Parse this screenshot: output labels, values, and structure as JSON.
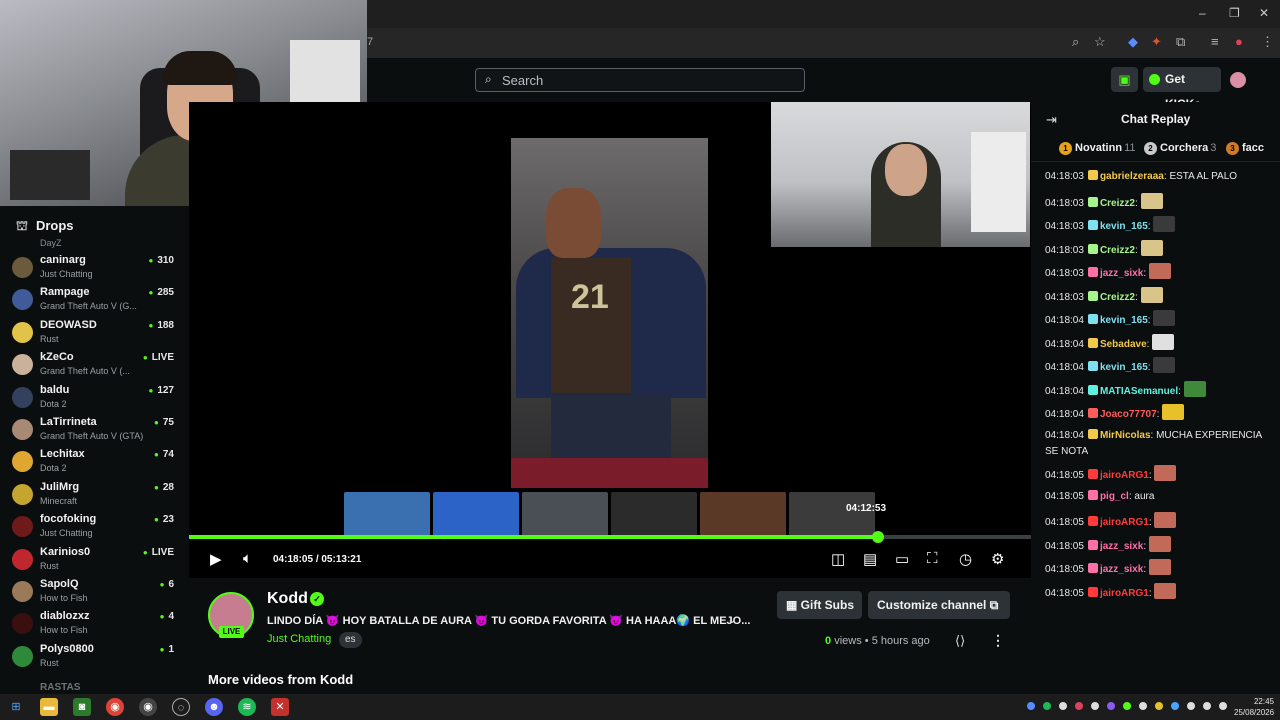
{
  "browser": {
    "address_fragment": "7",
    "window_controls": {
      "minimize": "–",
      "restore": "❐",
      "close": "✕"
    }
  },
  "header": {
    "search_placeholder": "Search",
    "get_kicks_label": "Get KICKs"
  },
  "sidebar": {
    "title": "Drops",
    "cut_top_text": "DayZ",
    "channels": [
      {
        "name": "caninarg",
        "category": "Just Chatting",
        "viewers": "310",
        "avatar_color": "#6b5a3c"
      },
      {
        "name": "Rampage",
        "category": "Grand Theft Auto V (G...",
        "viewers": "285",
        "avatar_color": "#3f5b9a"
      },
      {
        "name": "DEOWASD",
        "category": "Rust",
        "viewers": "188",
        "avatar_color": "#e2c34a"
      },
      {
        "name": "kZeCo",
        "category": "Grand Theft Auto V (...",
        "viewers": "LIVE",
        "avatar_color": "#c9b19a"
      },
      {
        "name": "baldu",
        "category": "Dota 2",
        "viewers": "127",
        "avatar_color": "#33415f"
      },
      {
        "name": "LaTirrineta",
        "category": "Grand Theft Auto V (GTA)",
        "viewers": "75",
        "avatar_color": "#a88a74"
      },
      {
        "name": "Lechitax",
        "category": "Dota 2",
        "viewers": "74",
        "avatar_color": "#e0a632"
      },
      {
        "name": "JuliMrg",
        "category": "Minecraft",
        "viewers": "28",
        "avatar_color": "#c3a52f"
      },
      {
        "name": "focofoking",
        "category": "Just Chatting",
        "viewers": "23",
        "avatar_color": "#6e1a1a"
      },
      {
        "name": "Karinios0",
        "category": "Rust",
        "viewers": "LIVE",
        "avatar_color": "#c0262e"
      },
      {
        "name": "SapolQ",
        "category": "How to Fish",
        "viewers": "6",
        "avatar_color": "#9b7a5a"
      },
      {
        "name": "diablozxz",
        "category": "How to Fish",
        "viewers": "4",
        "avatar_color": "#3a0f10"
      },
      {
        "name": "Polys0800",
        "category": "Rust",
        "viewers": "1",
        "avatar_color": "#2e8a3a"
      }
    ],
    "bottom_cut_text": "RASTAS"
  },
  "player": {
    "hover_timecode": "04:12:53",
    "current_time": "04:18:05",
    "separator": "/",
    "duration": "05:13:21",
    "progress_fraction": 0.818,
    "thumb_colors": [
      "#3a6fb0",
      "#2b63c7",
      "#4a4f55",
      "#2b2b2b",
      "#5a3a26",
      "#3b3b3b"
    ]
  },
  "stream": {
    "streamer": "Kodd",
    "live_label": "LIVE",
    "title": "LINDO DÍA 😈 HOY BATALLA DE AURA 😈 TU GORDA FAVORITA 😈 HA HAAA🌍 EL MEJO...",
    "category": "Just Chatting",
    "language": "es",
    "gift_subs_label": "Gift Subs",
    "customize_label": "Customize channel",
    "views_count": "0",
    "views_label": "views",
    "age": "5 hours ago",
    "more_videos_label": "More videos from Kodd"
  },
  "chat": {
    "title": "Chat Replay",
    "leaderboard": [
      {
        "rank": "1",
        "name": "Novatinn",
        "count": "11",
        "color": "#e8a21a"
      },
      {
        "rank": "2",
        "name": "Corchera",
        "count": "3",
        "color": "#c9c9c9"
      },
      {
        "rank": "3",
        "name": "facc",
        "count": "",
        "color": "#d07a2a"
      }
    ],
    "messages": [
      {
        "time": "04:18:03",
        "user": "gabrielzeraaa",
        "text": "ESTA AL PALO",
        "color": "#f2c94c",
        "emote": ""
      },
      {
        "time": "04:18:03",
        "user": "Creizz2",
        "text": "",
        "color": "#a6f58a",
        "emote": "#d9c48a"
      },
      {
        "time": "04:18:03",
        "user": "kevin_165",
        "text": "",
        "color": "#7ee0f0",
        "emote": "#3a3a3a"
      },
      {
        "time": "04:18:03",
        "user": "Creizz2",
        "text": "",
        "color": "#a6f58a",
        "emote": "#d9c48a"
      },
      {
        "time": "04:18:03",
        "user": "jazz_sixk",
        "text": "",
        "color": "#ff6fa8",
        "emote": "#c26a5a"
      },
      {
        "time": "04:18:03",
        "user": "Creizz2",
        "text": "",
        "color": "#a6f58a",
        "emote": "#d9c48a"
      },
      {
        "time": "04:18:04",
        "user": "kevin_165",
        "text": "",
        "color": "#7ee0f0",
        "emote": "#3a3a3a"
      },
      {
        "time": "04:18:04",
        "user": "Sebadave",
        "text": "",
        "color": "#f2c94c",
        "emote": "#e0e0e0"
      },
      {
        "time": "04:18:04",
        "user": "kevin_165",
        "text": "",
        "color": "#7ee0f0",
        "emote": "#3a3a3a"
      },
      {
        "time": "04:18:04",
        "user": "MATIASemanuel",
        "text": "",
        "color": "#5ff0e0",
        "emote": "#3e8a3a"
      },
      {
        "time": "04:18:04",
        "user": "Joaco77707",
        "text": "",
        "color": "#ff5c5c",
        "emote": "#e8c02a"
      },
      {
        "time": "04:18:04",
        "user": "MirNicolas",
        "text": "MUCHA EXPERIENCIA SE NOTA",
        "color": "#f2c94c",
        "emote": ""
      },
      {
        "time": "04:18:05",
        "user": "jairoARG1",
        "text": "",
        "color": "#ff3b3b",
        "emote": "#c26a5a"
      },
      {
        "time": "04:18:05",
        "user": "pig_cl",
        "text": "aura",
        "color": "#ff6fa8",
        "emote": ""
      },
      {
        "time": "04:18:05",
        "user": "jairoARG1",
        "text": "",
        "color": "#ff3b3b",
        "emote": "#c26a5a"
      },
      {
        "time": "04:18:05",
        "user": "jazz_sixk",
        "text": "",
        "color": "#ff6fa8",
        "emote": "#c26a5a"
      },
      {
        "time": "04:18:05",
        "user": "jazz_sixk",
        "text": "",
        "color": "#ff6fa8",
        "emote": "#c26a5a"
      },
      {
        "time": "04:18:05",
        "user": "jairoARG1",
        "text": "",
        "color": "#ff3b3b",
        "emote": "#c26a5a"
      }
    ]
  },
  "taskbar": {
    "time": "22:45",
    "date": "25/08/2026"
  },
  "colors": {
    "accent": "#53fc18",
    "bg": "#0b0e0f",
    "panel": "#2c3236"
  }
}
